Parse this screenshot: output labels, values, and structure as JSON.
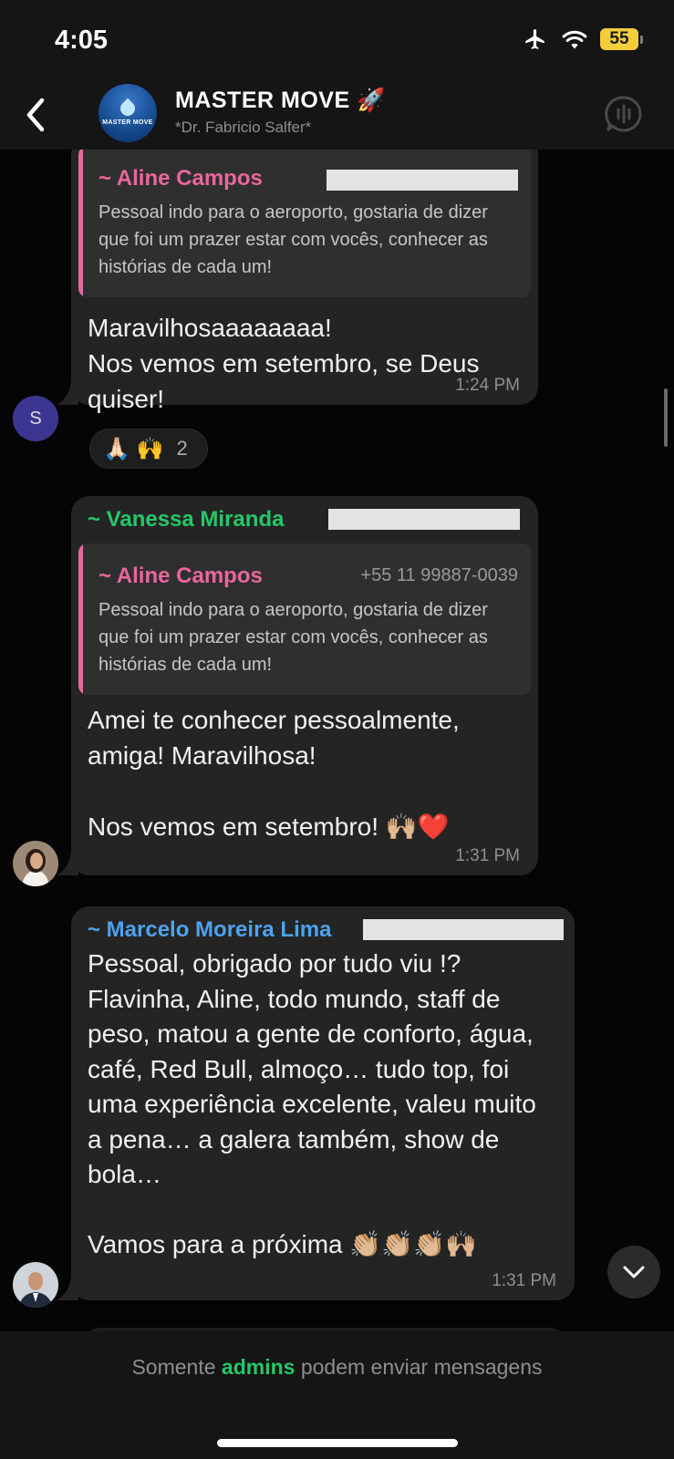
{
  "status": {
    "time": "4:05",
    "battery": "55"
  },
  "header": {
    "title": "MASTER MOVE 🚀",
    "subtitle": "*Dr. Fabricio Salfer*",
    "avatar_text": "MASTER MOVE"
  },
  "messages": [
    {
      "quote": {
        "name": "~ Aline Campos",
        "text": "Pessoal indo para o aeroporto, gostaria de dizer que foi um prazer estar com vocês, conhecer as histórias de cada um!"
      },
      "text": "Maravilhosaaaaaaaa!\nNos vemos em setembro, se Deus quiser!",
      "time": "1:24 PM",
      "avatar_initial": "S",
      "reaction": {
        "emojis": "🙏🏻 🙌",
        "count": "2"
      }
    },
    {
      "sender": "~ Vanessa Miranda",
      "quote": {
        "name": "~ Aline Campos",
        "phone": "+55 11 99887-0039",
        "text": "Pessoal indo para o aeroporto, gostaria de dizer que foi um prazer estar com vocês, conhecer as histórias de cada um!"
      },
      "text": "Amei te conhecer pessoalmente, amiga! Maravilhosa!\n\nNos vemos em setembro! 🙌🏼❤️",
      "time": "1:31 PM"
    },
    {
      "sender": "~ Marcelo Moreira Lima",
      "text": "Pessoal, obrigado por tudo viu !? Flavinha, Aline, todo mundo, staff de peso, matou a gente de conforto, água, café, Red Bull, almoço… tudo top, foi uma experiência excelente, valeu muito a pena… a galera também, show de bola…\n\nVamos para a próxima 👏🏼👏🏼👏🏼🙌🏼",
      "time": "1:31 PM"
    }
  ],
  "footer": {
    "prefix": "Somente ",
    "highlight": "admins",
    "suffix": " podem enviar mensagens"
  },
  "colors": {
    "vanessa": "#25c767",
    "marcelo": "#4ea2ef",
    "aline": "#e9679d",
    "admins": "#25c767",
    "battery": "#f4cd3a"
  }
}
